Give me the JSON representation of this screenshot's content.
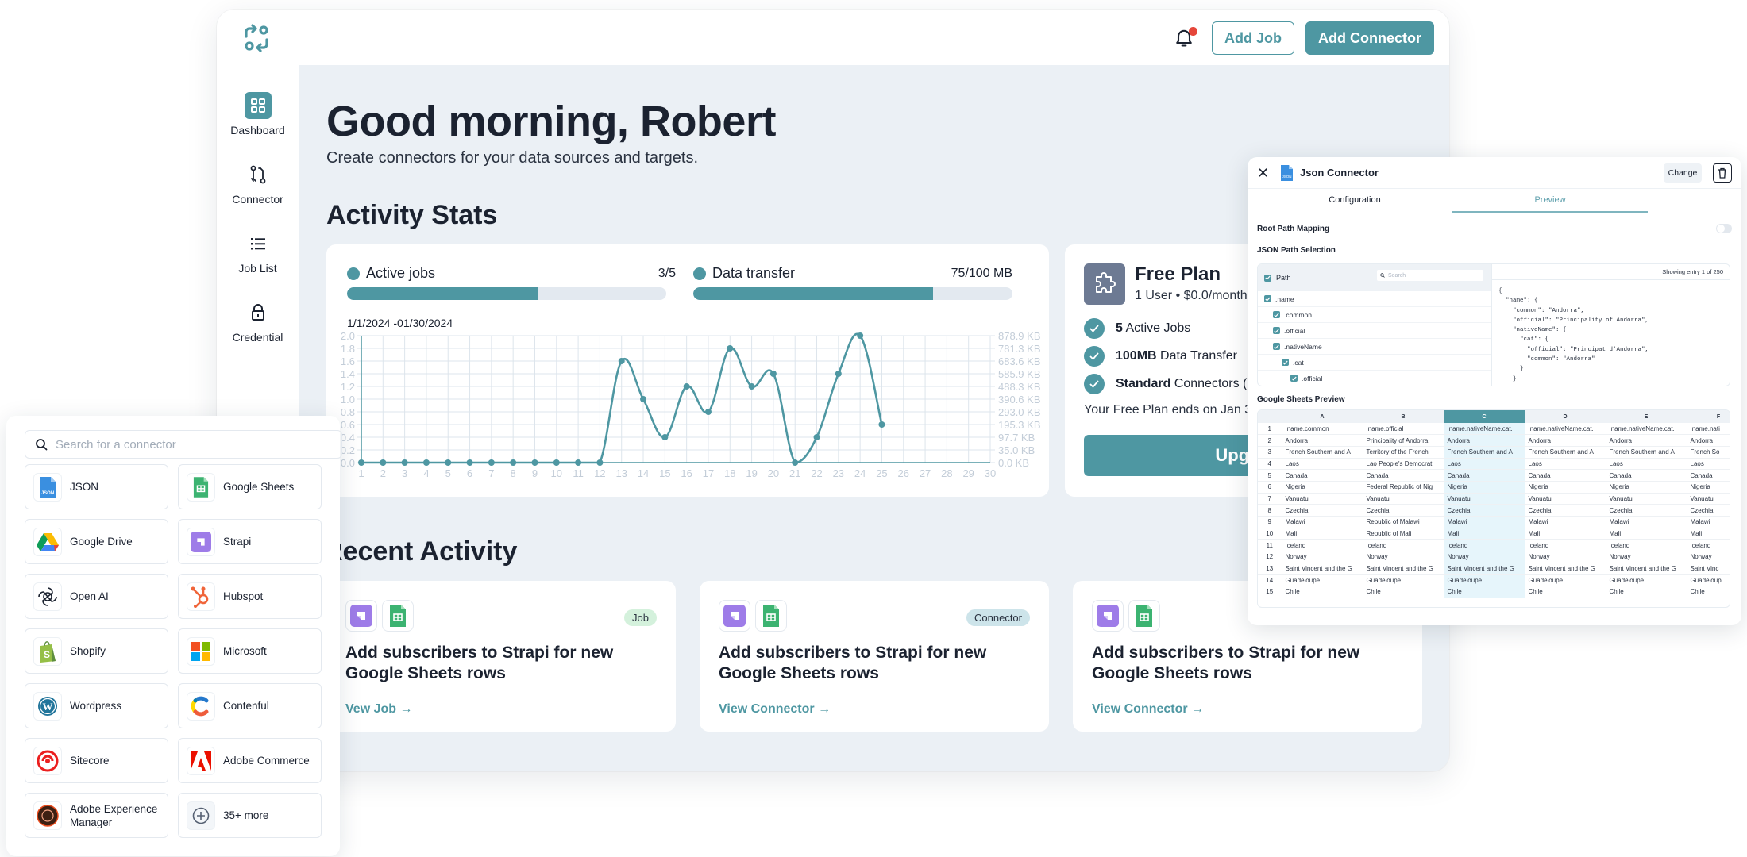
{
  "header": {
    "add_job_label": "Add Job",
    "add_connector_label": "Add Connector",
    "notification_has_unread": true
  },
  "sidebar": {
    "items": [
      {
        "label": "Dashboard",
        "icon": "dashboard-grid-icon",
        "active": true
      },
      {
        "label": "Connector",
        "icon": "connector-icon",
        "active": false
      },
      {
        "label": "Job List",
        "icon": "list-icon",
        "active": false
      },
      {
        "label": "Credential",
        "icon": "lock-icon",
        "active": false
      }
    ]
  },
  "main": {
    "greeting": "Good morning, Robert",
    "subtitle": "Create connectors for your data sources and targets.",
    "activity_stats_title": "Activity Stats",
    "recent_activity_title": "Recent Activity"
  },
  "stats": {
    "active_jobs": {
      "label": "Active jobs",
      "value_text": "3/5",
      "used": 3,
      "total": 5
    },
    "data_transfer": {
      "label": "Data transfer",
      "value_text": "75/100 MB",
      "used": 75,
      "total": 100
    },
    "date_range": "1/1/2024 -01/30/2024"
  },
  "chart_data": {
    "type": "line",
    "title": "",
    "date_range": "1/1/2024 -01/30/2024",
    "x": [
      1,
      2,
      3,
      4,
      5,
      6,
      7,
      8,
      9,
      10,
      11,
      12,
      13,
      14,
      15,
      16,
      17,
      18,
      19,
      20,
      21,
      22,
      23,
      24,
      25
    ],
    "x_ticks": [
      "1",
      "2",
      "3",
      "4",
      "5",
      "6",
      "7",
      "8",
      "9",
      "10",
      "11",
      "12",
      "13",
      "14",
      "15",
      "16",
      "17",
      "18",
      "19",
      "20",
      "21",
      "22",
      "23",
      "24",
      "25",
      "26",
      "27",
      "28",
      "29",
      "30"
    ],
    "values": [
      0,
      0,
      0,
      0,
      0,
      0,
      0,
      0,
      0,
      0,
      0,
      0,
      1.6,
      1.0,
      0.4,
      1.2,
      0.8,
      1.8,
      1.2,
      1.4,
      0.0,
      0.4,
      1.4,
      2.0,
      0.6
    ],
    "ylim": [
      0,
      2.0
    ],
    "y_ticks_left": [
      "0.0",
      "0.2",
      "0.4",
      "0.6",
      "0.8",
      "1.0",
      "1.2",
      "1.4",
      "1.6",
      "1.8",
      "2.0"
    ],
    "y_ticks_right": [
      "0.0 KB",
      "35.0 KB",
      "97.7 KB",
      "195.3 KB",
      "293.0 KB",
      "390.6 KB",
      "488.3 KB",
      "585.9 KB",
      "683.6 KB",
      "781.3 KB",
      "878.9 KB"
    ],
    "xlabel": "",
    "ylabel": "",
    "grid": true,
    "color": "#4e97a2"
  },
  "plan": {
    "title": "Free Plan",
    "subtitle": "1 User • $0.0/month",
    "features": [
      {
        "bold": "5",
        "text": " Active Jobs"
      },
      {
        "bold": "100MB",
        "text": " Data Transfer"
      },
      {
        "bold": "Standard",
        "text": " Connectors ("
      }
    ],
    "ends_text": "Your Free Plan ends on Jan 3",
    "upgrade_label": "Upgrade"
  },
  "recent": [
    {
      "title": "Add subscribers to Strapi for new Google Sheets rows",
      "badge": "Job",
      "link": "Vew Job"
    },
    {
      "title": "Add subscribers to Strapi for new Google Sheets rows",
      "badge": "Connector",
      "link": "View Connector"
    },
    {
      "title": "Add subscribers to Strapi for new Google Sheets rows",
      "badge": "",
      "link": "View Connector"
    }
  ],
  "picker": {
    "search_placeholder": "Search for a connector",
    "connectors": [
      {
        "name": "JSON",
        "icon": "json-file-icon"
      },
      {
        "name": "Google Sheets",
        "icon": "google-sheets-icon"
      },
      {
        "name": "Google Drive",
        "icon": "google-drive-icon"
      },
      {
        "name": "Strapi",
        "icon": "strapi-icon"
      },
      {
        "name": "Open AI",
        "icon": "openai-icon"
      },
      {
        "name": "Hubspot",
        "icon": "hubspot-icon"
      },
      {
        "name": "Shopify",
        "icon": "shopify-icon"
      },
      {
        "name": "Microsoft",
        "icon": "microsoft-icon"
      },
      {
        "name": "Wordpress",
        "icon": "wordpress-icon"
      },
      {
        "name": "Contenful",
        "icon": "contentful-icon"
      },
      {
        "name": "Sitecore",
        "icon": "sitecore-icon"
      },
      {
        "name": "Adobe Commerce",
        "icon": "adobe-icon"
      },
      {
        "name": "Adobe Experience Manager",
        "icon": "adobe-experience-manager-icon"
      },
      {
        "name": "35+ more",
        "icon": "plus-circle-icon"
      }
    ]
  },
  "json_panel": {
    "title": "Json Connector",
    "change_label": "Change",
    "tabs": [
      "Configuration",
      "Preview"
    ],
    "active_tab": 1,
    "root_path_label": "Root Path Mapping",
    "root_path_enabled": false,
    "path_selection_label": "JSON Path Selection",
    "path_header": "Path",
    "path_search_placeholder": "Search",
    "paths": [
      {
        "label": ".name",
        "depth": 0
      },
      {
        "label": ".common",
        "depth": 1
      },
      {
        "label": ".official",
        "depth": 1
      },
      {
        "label": ".nativeName",
        "depth": 1
      },
      {
        "label": ".cat",
        "depth": 2
      },
      {
        "label": ".official",
        "depth": 3
      }
    ],
    "showing_entry": "Showing entry 1 of 250",
    "json_preview": "{\n  \"name\": {\n    \"common\": \"Andorra\",\n    \"official\": \"Principality of Andorra\",\n    \"nativeName\": {\n      \"cat\": {\n        \"official\": \"Principat d'Andorra\",\n        \"common\": \"Andorra\"\n      }\n    }",
    "sheets_label": "Google Sheets Preview",
    "sheet_columns": [
      "A",
      "B",
      "C",
      "D",
      "E",
      "F"
    ],
    "selected_column": "C",
    "sheet_rows": [
      [
        ".name.common",
        ".name.official",
        ".name.nativeName.cat.",
        ".name.nativeName.cat.",
        ".name.nativeName.cat.",
        ".name.nati"
      ],
      [
        "Andorra",
        "Principality of Andorra",
        "Andorra",
        "Andorra",
        "Andorra",
        "Andorra"
      ],
      [
        "French Southern and A",
        "Territory of the French",
        "French Southern and A",
        "French Southern and A",
        "French Southern and A",
        "French So"
      ],
      [
        "Laos",
        "Lao People's Democrat",
        "Laos",
        "Laos",
        "Laos",
        "Laos"
      ],
      [
        "Canada",
        "Canada",
        "Canada",
        "Canada",
        "Canada",
        "Canada"
      ],
      [
        "Nigeria",
        "Federal Republic of Nig",
        "Nigeria",
        "Nigeria",
        "Nigeria",
        "Nigeria"
      ],
      [
        "Vanuatu",
        "Vanuatu",
        "Vanuatu",
        "Vanuatu",
        "Vanuatu",
        "Vanuatu"
      ],
      [
        "Czechia",
        "Czechia",
        "Czechia",
        "Czechia",
        "Czechia",
        "Czechia"
      ],
      [
        "Malawi",
        "Republic of Malawi",
        "Malawi",
        "Malawi",
        "Malawi",
        "Malawi"
      ],
      [
        "Mali",
        "Republic of Mali",
        "Mali",
        "Mali",
        "Mali",
        "Mali"
      ],
      [
        "Iceland",
        "Iceland",
        "Iceland",
        "Iceland",
        "Iceland",
        "Iceland"
      ],
      [
        "Norway",
        "Norway",
        "Norway",
        "Norway",
        "Norway",
        "Norway"
      ],
      [
        "Saint Vincent and the G",
        "Saint Vincent and the G",
        "Saint Vincent and the G",
        "Saint Vincent and the G",
        "Saint Vincent and the G",
        "Saint Vinc"
      ],
      [
        "Guadeloupe",
        "Guadeloupe",
        "Guadeloupe",
        "Guadeloupe",
        "Guadeloupe",
        "Guadeloup"
      ],
      [
        "Chile",
        "Chile",
        "Chile",
        "Chile",
        "Chile",
        "Chile"
      ]
    ]
  },
  "colors": {
    "accent": "#4e97a2",
    "notification": "#e5463a",
    "plan_icon_bg": "#6d7a93",
    "job_badge": "#d4f1dc",
    "connector_badge": "#cde4ea"
  }
}
